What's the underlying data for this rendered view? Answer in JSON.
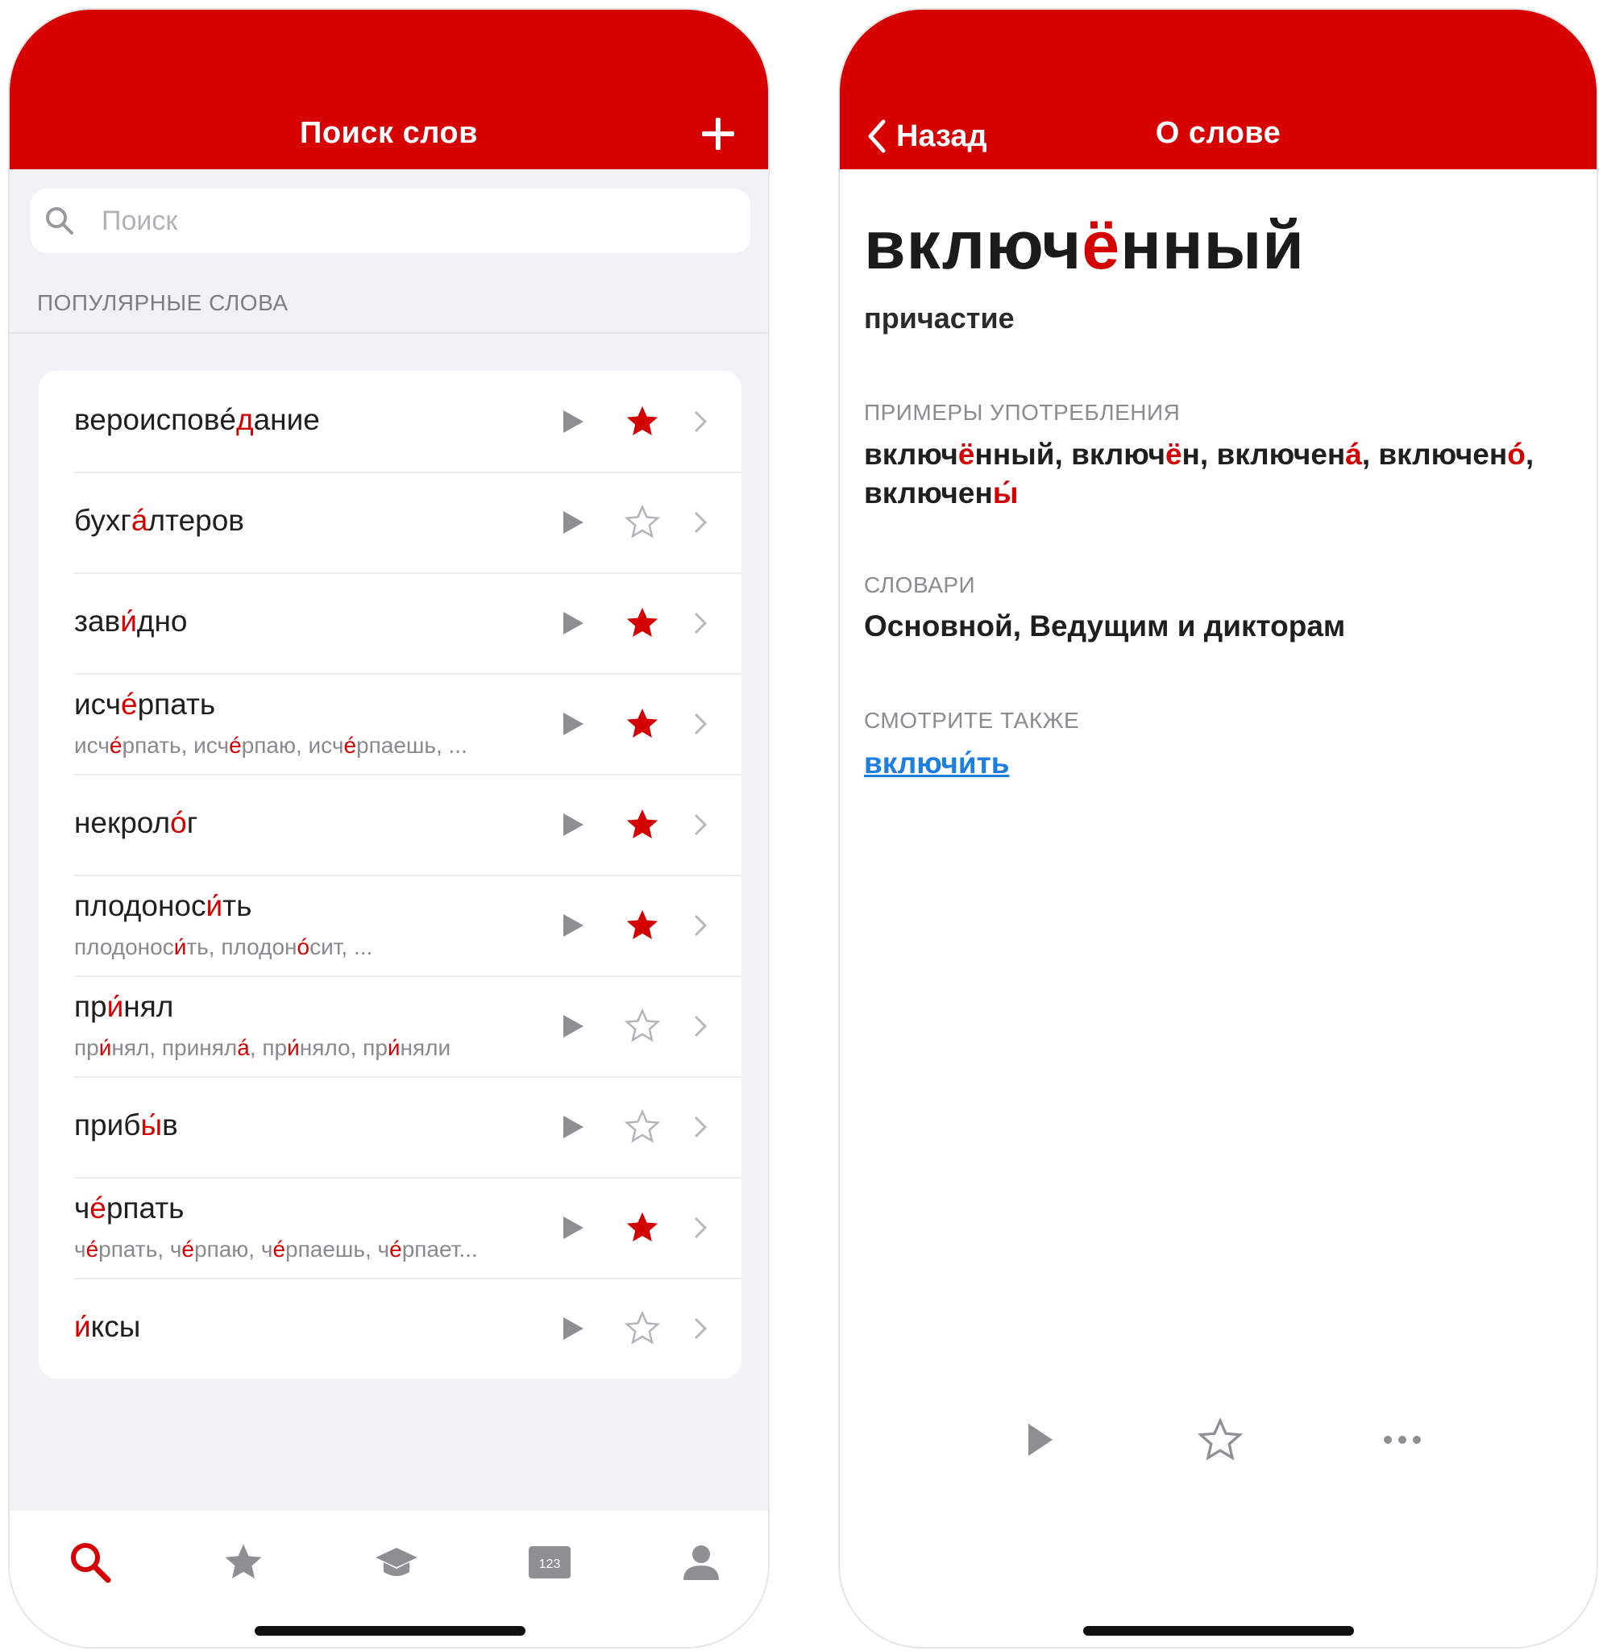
{
  "colors": {
    "brand": "#d70000",
    "accent": "#d40000",
    "link": "#1c7ee0"
  },
  "left": {
    "nav_title": "Поиск слов",
    "add_icon": "plus-icon",
    "search_placeholder": "Поиск",
    "section_header": "ПОПУЛЯРНЫЕ СЛОВА",
    "words": [
      {
        "parts": [
          "вероисповéдание"
        ],
        "accent_index": 11,
        "word": "вероисповéдание",
        "forms": "",
        "favorite": true
      },
      {
        "word": "бухгáлтеров",
        "forms": "",
        "favorite": false
      },
      {
        "word": "завúдно",
        "forms": "",
        "favorite": true
      },
      {
        "word": "исчéрпать",
        "forms": "исчéрпать, исчéрпаю, исчéрпаешь, ...",
        "favorite": true
      },
      {
        "word": "некролóг",
        "forms": "",
        "favorite": true
      },
      {
        "word": "плодоносúть",
        "forms": "плодоносúть, плодонóсит, ...",
        "favorite": true
      },
      {
        "word": "прúнял",
        "forms": "прúнял, приня ла́, прúняло, прúняли",
        "favorite": false
      },
      {
        "word": "прибы́в",
        "forms": "",
        "favorite": false
      },
      {
        "word": "чéрпать",
        "forms": "чéрпать, чéрпаю, чéрпаешь, чéрпает...",
        "favorite": true
      },
      {
        "word": "и́ксы",
        "forms": "",
        "favorite": false
      }
    ],
    "tabs": [
      "search-icon",
      "favorites-star-icon",
      "learning-cap-icon",
      "numbers-123-icon",
      "profile-icon"
    ]
  },
  "right": {
    "back_label": "Назад",
    "nav_title": "О слове",
    "word": "включённый",
    "part_of_speech": "причастие",
    "examples_label": "ПРИМЕРЫ УПОТРЕБЛЕНИЯ",
    "examples": "включённый, включён, включенá, включенó, включены́",
    "dictionaries_label": "СЛОВАРИ",
    "dictionaries": "Основной, Ведущим и дикторам",
    "see_also_label": "СМОТРИТЕ ТАКЖЕ",
    "see_also": "включúть",
    "actions": [
      "play-icon",
      "star-outline-icon",
      "more-dots-icon"
    ]
  }
}
